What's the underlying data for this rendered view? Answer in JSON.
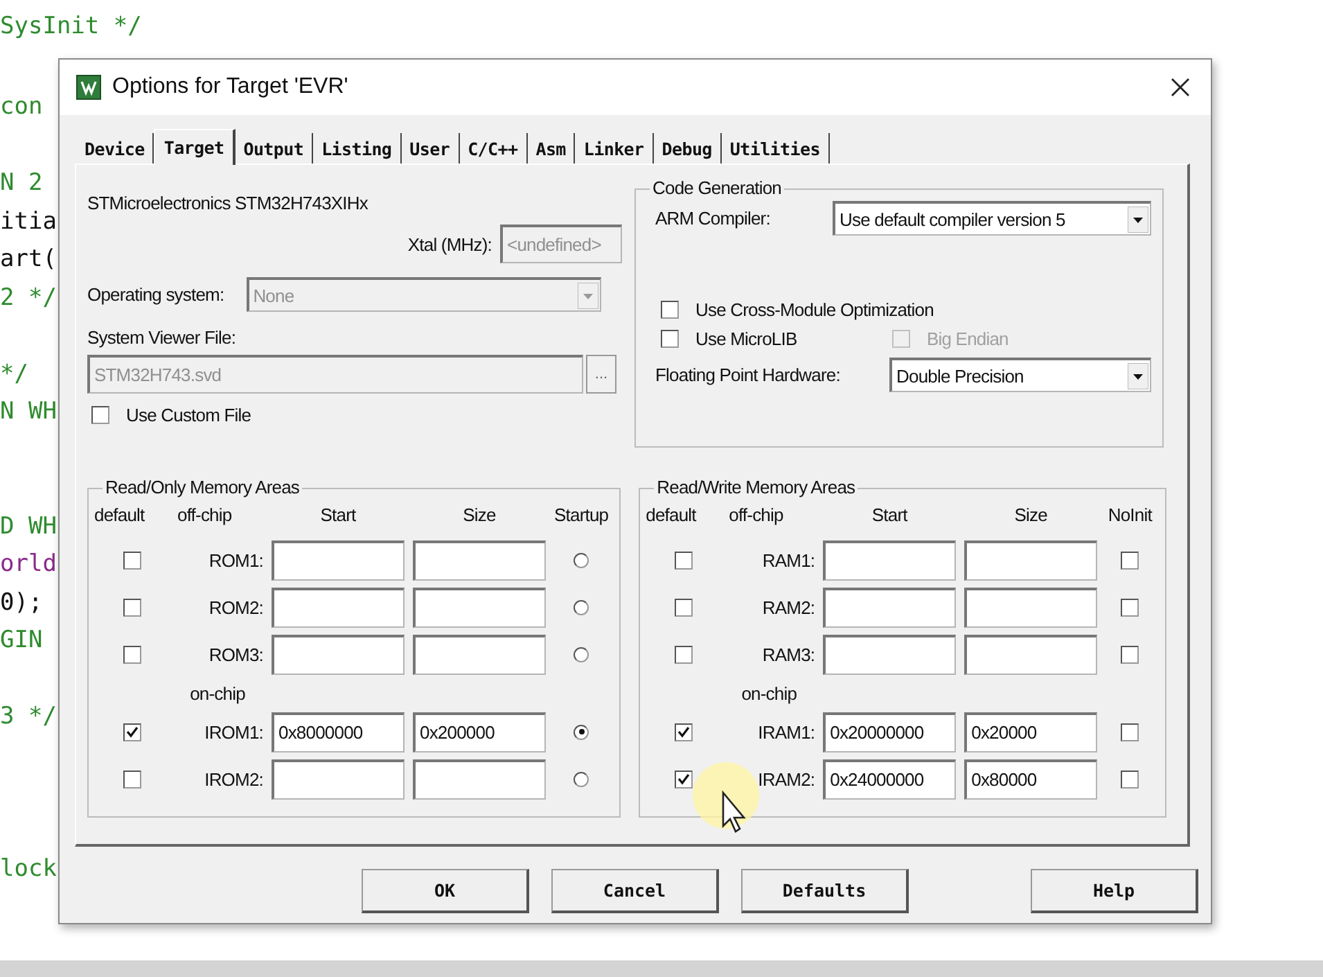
{
  "editor": {
    "lines": [
      {
        "kind": "comment",
        "text": "SysInit */"
      },
      {
        "kind": "comment",
        "text": "con"
      },
      {
        "kind": "blank"
      },
      {
        "kind": "comment",
        "text": "N 2"
      },
      {
        "kind": "code",
        "text": "itia"
      },
      {
        "kind": "code",
        "text": "art("
      },
      {
        "kind": "comment",
        "text": "2 */"
      },
      {
        "kind": "blank"
      },
      {
        "kind": "comment",
        "text": "*/"
      },
      {
        "kind": "comment",
        "text": "N WH"
      },
      {
        "kind": "blank"
      },
      {
        "kind": "blank"
      },
      {
        "kind": "comment",
        "text": "D WH"
      },
      {
        "kind": "string",
        "text": "orld"
      },
      {
        "kind": "code",
        "text": "0);"
      },
      {
        "kind": "comment",
        "text": "GIN"
      },
      {
        "kind": "blank"
      },
      {
        "kind": "comment",
        "text": "3 */"
      },
      {
        "kind": "blank"
      },
      {
        "kind": "blank"
      },
      {
        "kind": "blank"
      },
      {
        "kind": "comment",
        "text": "lock"
      }
    ]
  },
  "window": {
    "title": "Options for Target 'EVR'"
  },
  "tabs": [
    {
      "label": "Device",
      "selected": false
    },
    {
      "label": "Target",
      "selected": true
    },
    {
      "label": "Output",
      "selected": false
    },
    {
      "label": "Listing",
      "selected": false
    },
    {
      "label": "User",
      "selected": false
    },
    {
      "label": "C/C++",
      "selected": false
    },
    {
      "label": "Asm",
      "selected": false
    },
    {
      "label": "Linker",
      "selected": false
    },
    {
      "label": "Debug",
      "selected": false
    },
    {
      "label": "Utilities",
      "selected": false
    }
  ],
  "device": {
    "name": "STMicroelectronics STM32H743XIHx",
    "xtal": {
      "label": "Xtal (MHz):",
      "value": "<undefined>",
      "disabled": true
    },
    "operating_system": {
      "label": "Operating system:",
      "value": "None",
      "disabled": true
    },
    "system_viewer_file": {
      "label": "System Viewer File:",
      "value": "STM32H743.svd",
      "disabled": true,
      "browse": "..."
    },
    "use_custom_file": {
      "label": "Use Custom File",
      "checked": false
    }
  },
  "code_generation": {
    "title": "Code Generation",
    "arm_compiler": {
      "label": "ARM Compiler:",
      "value": "Use default compiler version 5"
    },
    "options": [
      {
        "label": "Use Cross-Module Optimization",
        "checked": false,
        "disabled": false
      },
      {
        "label": "Use MicroLIB",
        "checked": false,
        "disabled": false
      },
      {
        "label": "Big Endian",
        "checked": false,
        "disabled": true
      }
    ],
    "fpu": {
      "label": "Floating Point Hardware:",
      "value": "Double Precision"
    }
  },
  "memory_groups": [
    {
      "title": "Read/Only Memory Areas",
      "columns": [
        "default",
        "off-chip",
        "Start",
        "Size",
        "Startup"
      ],
      "kind": "radio",
      "rows": [
        {
          "kind": "area",
          "label": "ROM1:",
          "default": false,
          "mark": false
        },
        {
          "kind": "area",
          "label": "ROM2:",
          "default": false,
          "mark": false
        },
        {
          "kind": "area",
          "label": "ROM3:",
          "default": false,
          "mark": false
        },
        {
          "kind": "heading",
          "label": "on-chip"
        },
        {
          "kind": "area",
          "label": "IROM1:",
          "default": true,
          "start": "0x8000000",
          "size": "0x200000",
          "mark": true
        },
        {
          "kind": "area",
          "label": "IROM2:",
          "default": false,
          "mark": false
        }
      ]
    },
    {
      "title": "Read/Write Memory Areas",
      "columns": [
        "default",
        "off-chip",
        "Start",
        "Size",
        "NoInit"
      ],
      "kind": "checkbox",
      "rows": [
        {
          "kind": "area",
          "label": "RAM1:",
          "default": false,
          "mark": false
        },
        {
          "kind": "area",
          "label": "RAM2:",
          "default": false,
          "mark": false
        },
        {
          "kind": "area",
          "label": "RAM3:",
          "default": false,
          "mark": false
        },
        {
          "kind": "heading",
          "label": "on-chip"
        },
        {
          "kind": "area",
          "label": "IRAM1:",
          "default": true,
          "start": "0x20000000",
          "size": "0x20000",
          "mark": false
        },
        {
          "kind": "area",
          "label": "IRAM2:",
          "default": true,
          "start": "0x24000000",
          "size": "0x80000",
          "mark": false
        }
      ]
    }
  ],
  "buttons": [
    {
      "label": "OK",
      "kind": "action"
    },
    {
      "label": "Cancel",
      "kind": "action"
    },
    {
      "label": "Defaults",
      "kind": "action"
    },
    {
      "label": "Help",
      "kind": "help"
    }
  ]
}
